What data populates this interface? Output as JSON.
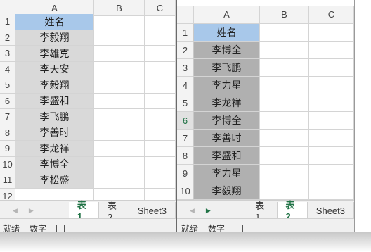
{
  "left": {
    "columns": [
      "A",
      "B",
      "C"
    ],
    "rows": [
      "1",
      "2",
      "3",
      "4",
      "5",
      "6",
      "7",
      "8",
      "9",
      "10",
      "11",
      "12"
    ],
    "header": "姓名",
    "names": [
      "李毅翔",
      "李雄克",
      "李天安",
      "李毅翔",
      "李盛和",
      "李飞鹏",
      "李善时",
      "李龙祥",
      "李博全",
      "李松盛"
    ],
    "tabs": [
      "表1",
      "表2",
      "Sheet3"
    ],
    "status": {
      "ready": "就绪",
      "mode": "数字"
    }
  },
  "right": {
    "columns": [
      "A",
      "B",
      "C"
    ],
    "rows": [
      "1",
      "2",
      "3",
      "4",
      "5",
      "6",
      "7",
      "8",
      "9",
      "10"
    ],
    "header": "姓名",
    "names": [
      "李博全",
      "李飞鹏",
      "李力星",
      "李龙祥",
      "李博全",
      "李善时",
      "李盛和",
      "李力星",
      "李毅翔"
    ],
    "tabs": [
      "表1",
      "表2",
      "Sheet3"
    ],
    "status": {
      "ready": "就绪",
      "mode": "数字"
    }
  }
}
